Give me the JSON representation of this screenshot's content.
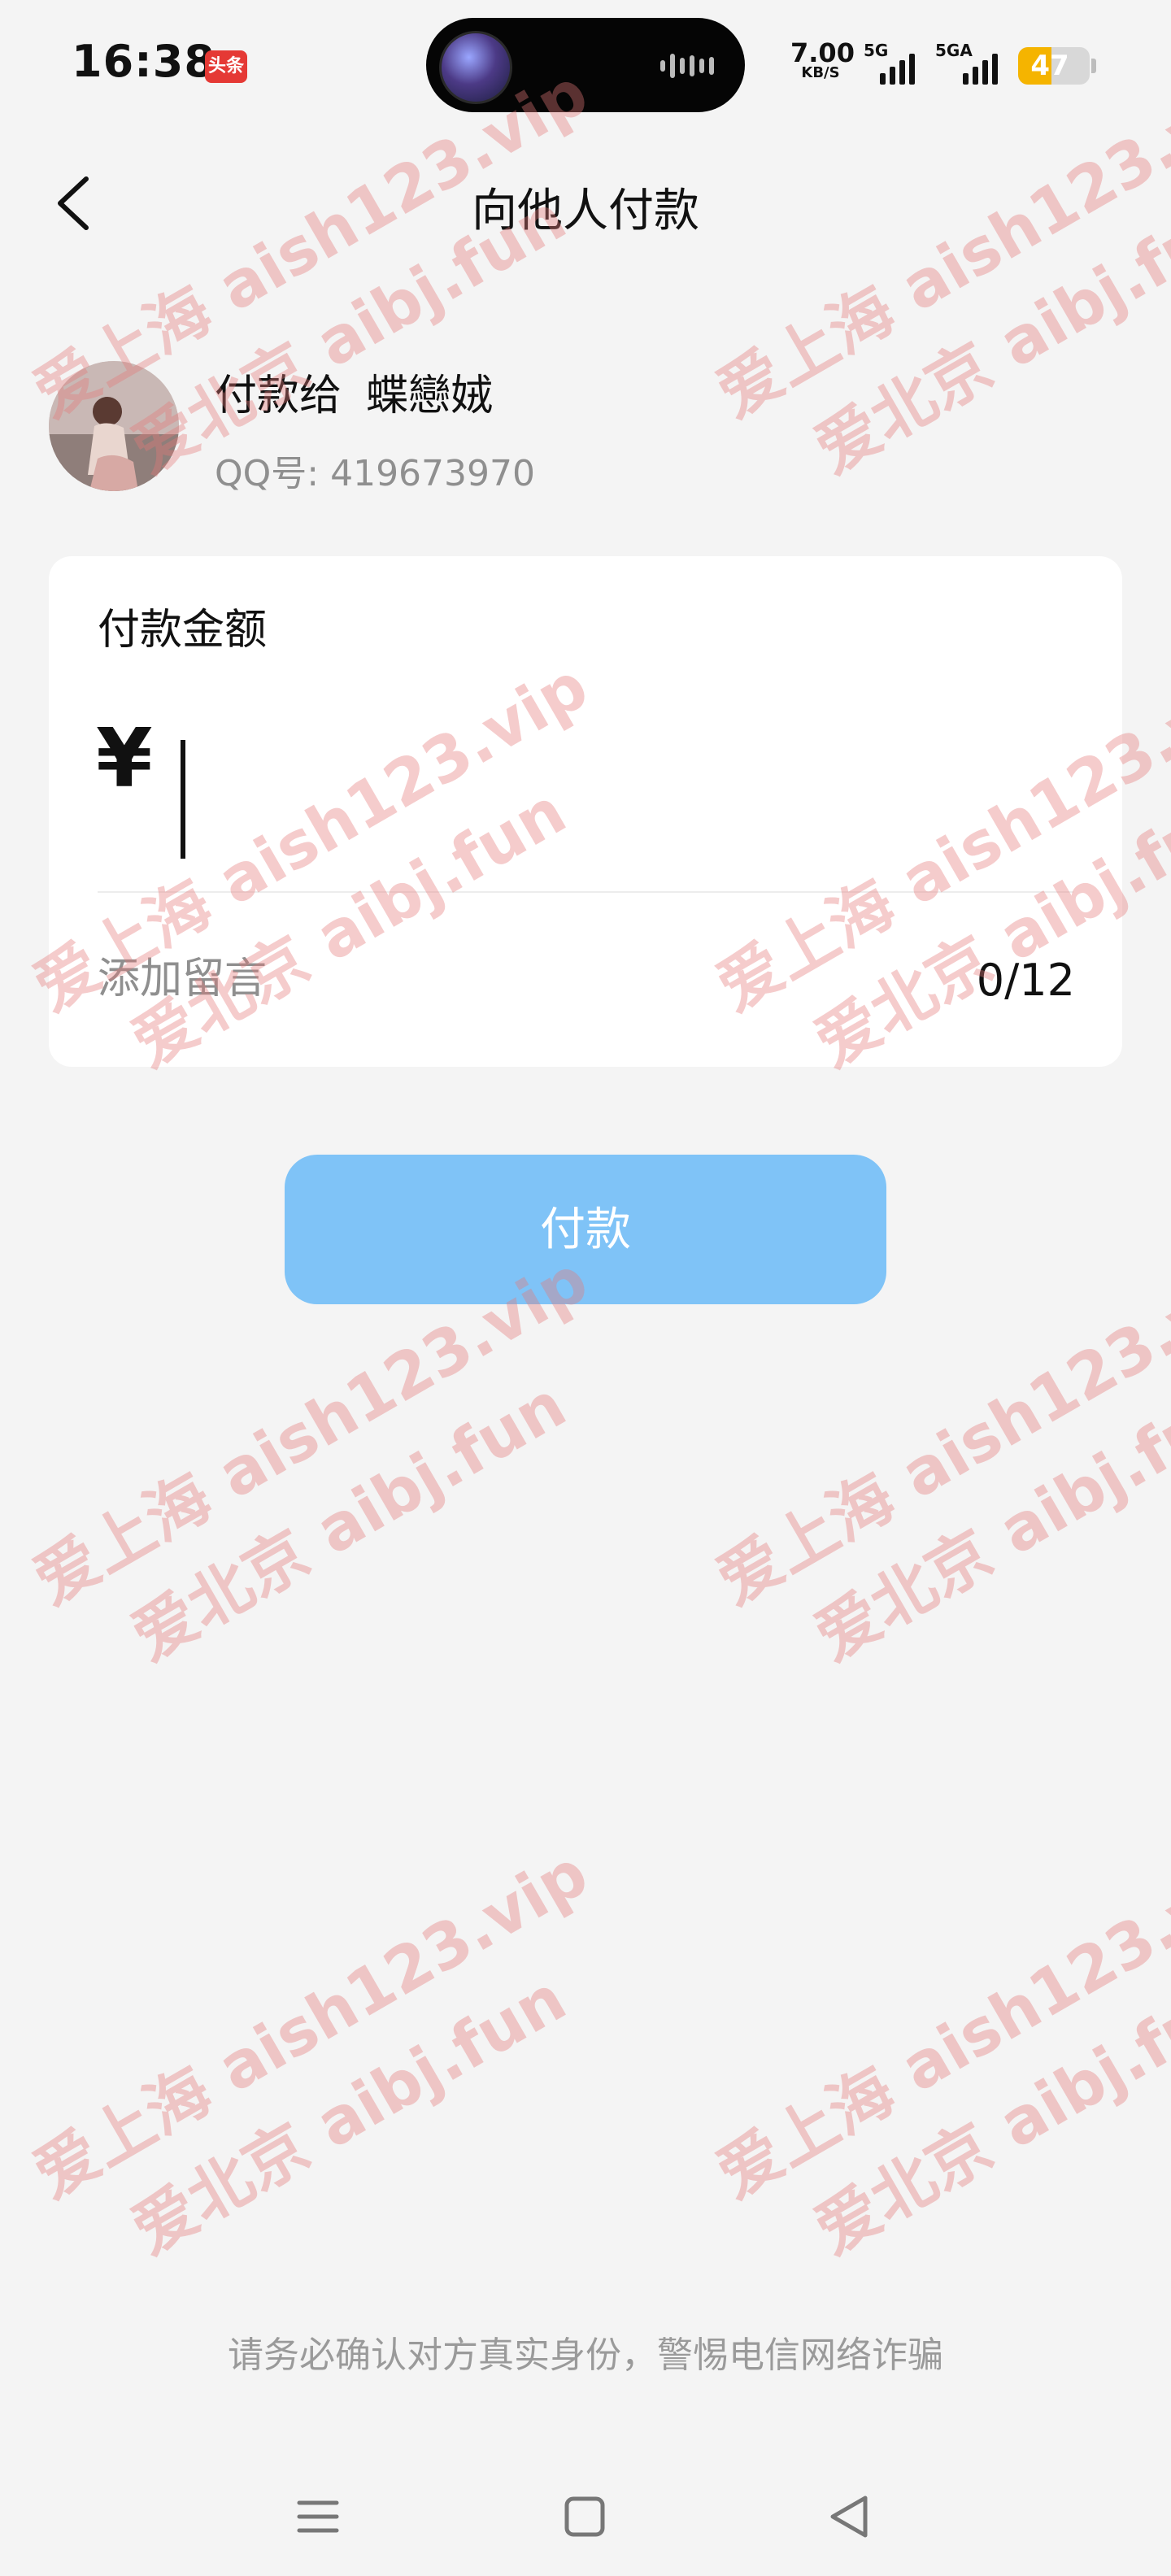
{
  "status_bar": {
    "time": "16:38",
    "app_badge": "头条",
    "net_speed_value": "7.00",
    "net_speed_unit": "KB/S",
    "signal1_label": "5G",
    "signal2_label": "5GA",
    "battery_level": "47"
  },
  "header": {
    "title": "向他人付款"
  },
  "payee": {
    "prefix": "付款给",
    "name": "蝶戀娀",
    "qq": "QQ号: 419673970"
  },
  "amount": {
    "label": "付款金额",
    "currency": "¥",
    "value": ""
  },
  "memo": {
    "placeholder": "添加留言",
    "counter": "0/12"
  },
  "pay_button": {
    "label": "付款"
  },
  "warning": "请务必确认对方真实身份，警惕电信网络诈骗",
  "watermark": {
    "line1": "爱上海 aish123.vip",
    "line2": "爱北京 aibj.fun"
  },
  "colors": {
    "pay_button": "#7fc3f7",
    "battery": "#f5b400",
    "watermark": "#e67878"
  }
}
